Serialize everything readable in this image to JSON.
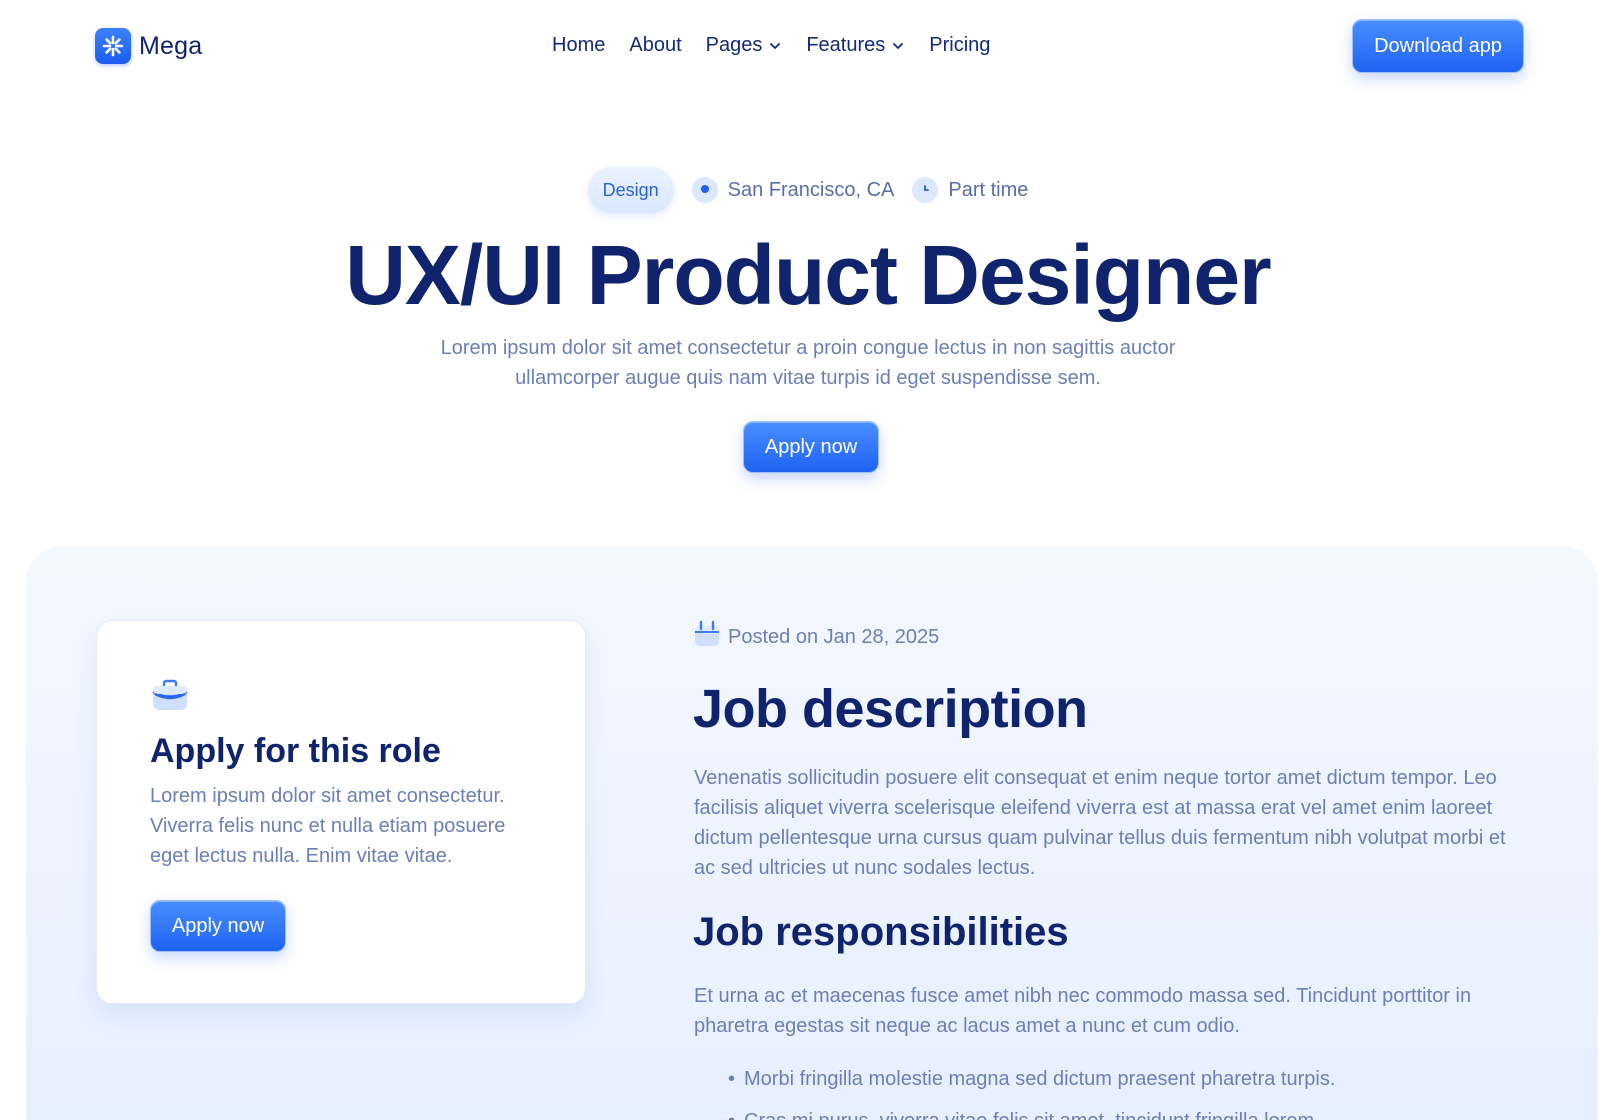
{
  "nav": {
    "brand": "Mega",
    "links": [
      {
        "label": "Home"
      },
      {
        "label": "About"
      },
      {
        "label": "Pages",
        "has_dropdown": true
      },
      {
        "label": "Features",
        "has_dropdown": true
      },
      {
        "label": "Pricing"
      }
    ],
    "cta": "Download app"
  },
  "hero": {
    "badge": "Design",
    "location": "San Francisco, CA",
    "employment_type": "Part time",
    "title": "UX/UI Product Designer",
    "description": "Lorem ipsum dolor sit amet consectetur a proin congue lectus in non sagittis auctor ullamcorper augue quis nam vitae turpis id eget suspendisse sem.",
    "apply_label": "Apply now"
  },
  "apply_card": {
    "icon": "briefcase-icon",
    "title": "Apply for this role",
    "text": "Lorem ipsum dolor sit amet consectetur. Viverra felis nunc et nulla etiam posuere eget lectus nulla. Enim vitae vitae.",
    "button": "Apply now"
  },
  "job": {
    "posted": "Posted on Jan 28, 2025",
    "description_heading": "Job description",
    "description": "Venenatis sollicitudin posuere elit consequat et enim neque tortor amet dictum tempor. Leo facilisis aliquet viverra scelerisque eleifend viverra est at massa erat vel amet enim laoreet dictum pellentesque urna cursus quam pulvinar tellus duis fermentum nibh volutpat morbi et ac sed ultricies ut nunc sodales lectus.",
    "responsibilities_heading": "Job responsibilities",
    "responsibilities_intro": "Et urna ac et maecenas fusce amet nibh nec commodo massa sed. Tincidunt porttitor in pharetra egestas sit neque ac lacus amet a nunc et cum odio.",
    "responsibilities": [
      "Morbi fringilla molestie magna sed dictum praesent pharetra turpis.",
      "Cras mi purus, viverra vitae felis sit amet, tincidunt fringilla lorem."
    ]
  },
  "colors": {
    "primary": "#1e63f2",
    "heading": "#10246e",
    "body_text": "#6c7fb6",
    "section_bg": "#eaf1ff"
  }
}
